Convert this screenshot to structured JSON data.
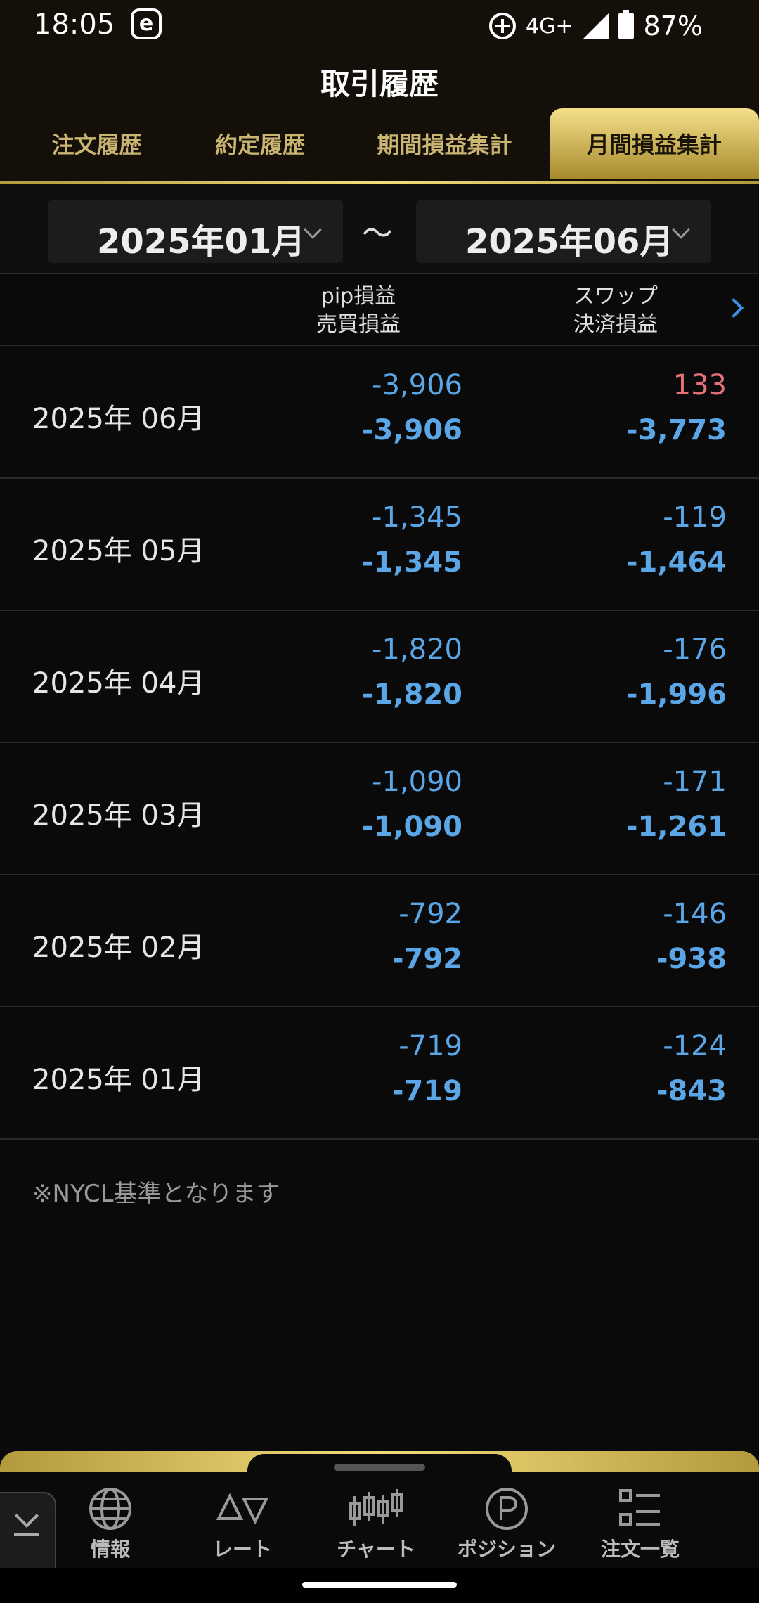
{
  "status_bar": {
    "time": "18:05",
    "network": "4G+",
    "battery": "87%"
  },
  "header": {
    "title": "取引履歴"
  },
  "tabs": [
    {
      "label": "注文履歴"
    },
    {
      "label": "約定履歴"
    },
    {
      "label": "期間損益集計"
    },
    {
      "label": "月間損益集計",
      "active": true
    }
  ],
  "range": {
    "from": "2025年01月",
    "separator": "～",
    "to": "2025年06月"
  },
  "columns": {
    "pip": "pip損益",
    "trade": "売買損益",
    "swap": "スワップ",
    "settle": "決済損益"
  },
  "rows": [
    {
      "month": "2025年 06月",
      "pip": "-3,906",
      "trade": "-3,906",
      "swap": "133",
      "settle": "-3,773"
    },
    {
      "month": "2025年 05月",
      "pip": "-1,345",
      "trade": "-1,345",
      "swap": "-119",
      "settle": "-1,464"
    },
    {
      "month": "2025年 04月",
      "pip": "-1,820",
      "trade": "-1,820",
      "swap": "-176",
      "settle": "-1,996"
    },
    {
      "month": "2025年 03月",
      "pip": "-1,090",
      "trade": "-1,090",
      "swap": "-171",
      "settle": "-1,261"
    },
    {
      "month": "2025年 02月",
      "pip": "-792",
      "trade": "-792",
      "swap": "-146",
      "settle": "-938"
    },
    {
      "month": "2025年 01月",
      "pip": "-719",
      "trade": "-719",
      "swap": "-124",
      "settle": "-843"
    }
  ],
  "note": "※NYCL基準となります",
  "bottom_nav": [
    {
      "label": "情報",
      "icon": "globe-icon"
    },
    {
      "label": "レート",
      "icon": "rate-icon"
    },
    {
      "label": "チャート",
      "icon": "candlestick-icon"
    },
    {
      "label": "ポジション",
      "icon": "position-icon"
    },
    {
      "label": "注文一覧",
      "icon": "list-icon"
    }
  ],
  "colors": {
    "gold": "#f2dd7a",
    "negative": "#5aa6e6",
    "positive": "#e8707a"
  }
}
